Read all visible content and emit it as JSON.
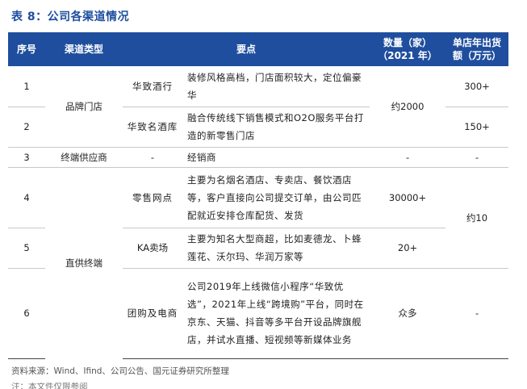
{
  "title": "表 8：公司各渠道情况",
  "headers": {
    "seq": "序号",
    "channel_type": "渠道类型",
    "points": "要点",
    "count": "数量（家）",
    "count_year": "（2021 年）",
    "avg": "单店年出货",
    "avg_unit": "额（万元）"
  },
  "rows": {
    "r1": {
      "seq": "1",
      "sub": "华致酒行",
      "points": "装修风格高档，门店面积较大，定位偏豪华",
      "avg": "300+"
    },
    "r2": {
      "seq": "2",
      "sub": "华致名酒库",
      "points": "融合传统线下销售模式和O2O服务平台打造的新零售门店",
      "avg": "150+"
    },
    "brand": {
      "type": "品牌门店",
      "count": "约2000"
    },
    "r3": {
      "seq": "3",
      "type": "终端供应商",
      "sub": "-",
      "points": "经销商",
      "count": "-",
      "avg": "-"
    },
    "r4": {
      "seq": "4",
      "sub": "零售网点",
      "points": "主要为名烟名酒店、专卖店、餐饮酒店等，客户直接向公司提交订单，由公司匹配就近安排仓库配货、发货",
      "count": "30000+",
      "avg": "约10"
    },
    "r5": {
      "seq": "5",
      "sub": "KA卖场",
      "points": "主要为知名大型商超，比如麦德龙、卜蜂莲花、沃尔玛、华润万家等",
      "count": "20+"
    },
    "r6": {
      "seq": "6",
      "sub": "团购及电商",
      "points": "公司2019年上线微信小程序“华致优选”，2021年上线“跨境购”平台，同时在京东、天猫、抖音等多平台开设品牌旗舰店，并试水直播、短视频等新媒体业务",
      "count": "众多",
      "avg": "-"
    },
    "direct": {
      "type": "直供终端"
    }
  },
  "source": "资料来源：Wind、Ifind、公司公告、国元证券研究所整理",
  "footnote_cut": "注：本文件仅限参阅"
}
